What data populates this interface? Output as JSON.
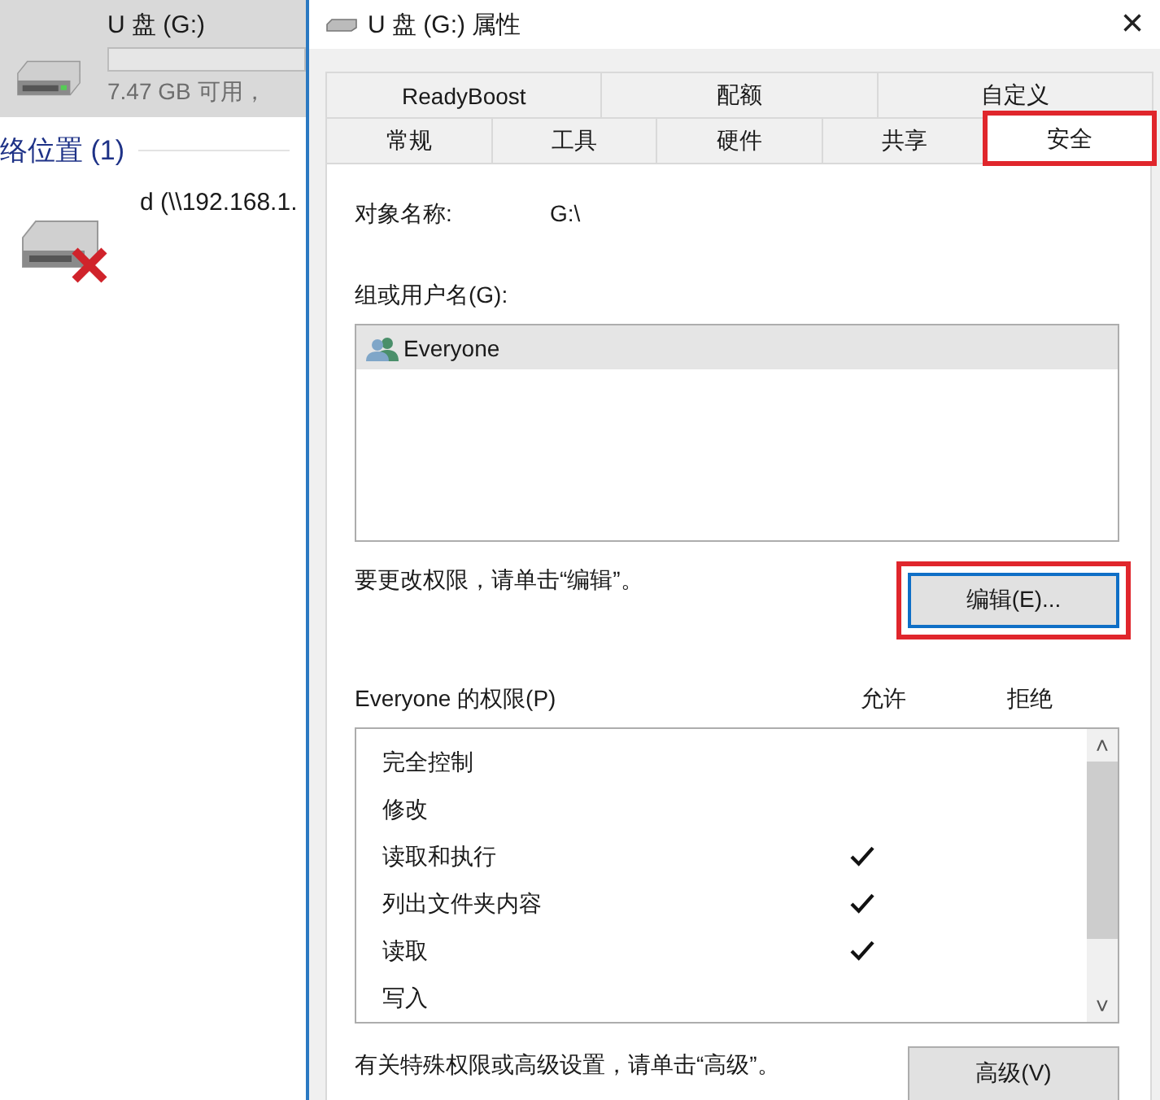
{
  "explorer": {
    "drive": {
      "name": "U 盘 (G:)",
      "free": "7.47 GB 可用，",
      "selected": true
    },
    "section": {
      "title": "络位置 (1)"
    },
    "network_drive": {
      "name": "d (\\\\192.168.1.",
      "disconnected": true
    }
  },
  "window": {
    "title": "U 盘 (G:) 属性",
    "close": "×"
  },
  "tab_rows": [
    [
      {
        "label": "ReadyBoost",
        "selected": false,
        "highlighted": false
      },
      {
        "label": "配额",
        "selected": false,
        "highlighted": false
      },
      {
        "label": "自定义",
        "selected": false,
        "highlighted": false
      }
    ],
    [
      {
        "label": "常规",
        "selected": false,
        "highlighted": false
      },
      {
        "label": "工具",
        "selected": false,
        "highlighted": false
      },
      {
        "label": "硬件",
        "selected": false,
        "highlighted": false
      },
      {
        "label": "共享",
        "selected": false,
        "highlighted": false
      },
      {
        "label": "安全",
        "selected": true,
        "highlighted": true
      }
    ]
  ],
  "object": {
    "label": "对象名称:",
    "value": "G:\\"
  },
  "groups": {
    "label": "组或用户名(G):",
    "items": [
      {
        "name": "Everyone",
        "selected": true
      }
    ]
  },
  "edit_hint": "要更改权限，请单击“编辑”。",
  "edit_button": {
    "label": "编辑(E)...",
    "highlighted": true
  },
  "permissions": {
    "label": "Everyone 的权限(P)",
    "allow_header": "允许",
    "deny_header": "拒绝",
    "rows": [
      {
        "name": "完全控制",
        "allow": false,
        "deny": false
      },
      {
        "name": "修改",
        "allow": false,
        "deny": false
      },
      {
        "name": "读取和执行",
        "allow": true,
        "deny": false
      },
      {
        "name": "列出文件夹内容",
        "allow": true,
        "deny": false
      },
      {
        "name": "读取",
        "allow": true,
        "deny": false
      },
      {
        "name": "写入",
        "allow": false,
        "deny": false
      }
    ],
    "scroll_up": "˄",
    "scroll_down": "˅"
  },
  "advanced_hint": "有关特殊权限或高级设置，请单击“高级”。",
  "advanced_button": {
    "label": "高级(V)"
  }
}
